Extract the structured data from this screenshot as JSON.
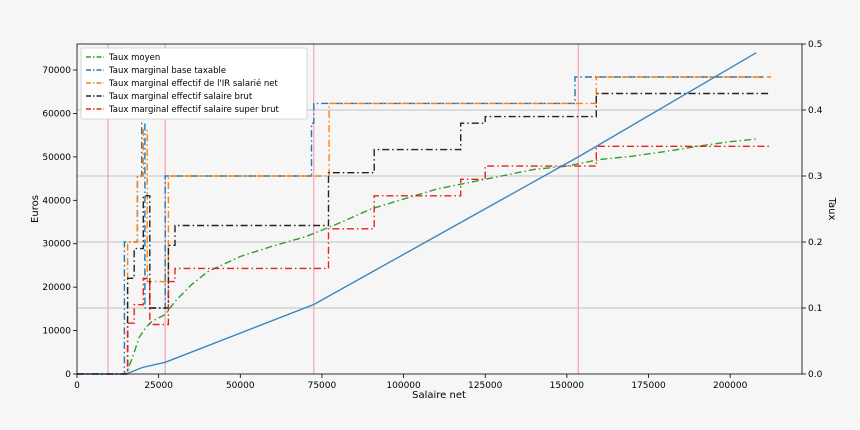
{
  "chart_data": {
    "type": "line",
    "xlabel": "Salaire net",
    "ylabel_left": "Euros",
    "ylabel_right": "Taux",
    "xlim": [
      0,
      222000
    ],
    "ylim_left": [
      0,
      76000
    ],
    "ylim_right": [
      0,
      0.5
    ],
    "x_ticks": [
      0,
      25000,
      50000,
      75000,
      100000,
      125000,
      150000,
      175000,
      200000
    ],
    "y_left_ticks": [
      0,
      10000,
      20000,
      30000,
      40000,
      50000,
      60000,
      70000
    ],
    "y_right_ticks": [
      0.0,
      0.1,
      0.2,
      0.3,
      0.4,
      0.5
    ],
    "grid_right": [
      0.1,
      0.2,
      0.3,
      0.4
    ],
    "vlines": [
      9500,
      27000,
      72500,
      153500
    ],
    "legend_placement": "top-left",
    "series": [
      {
        "name": "Taux moyen",
        "axis": "right",
        "color": "#2ca02c",
        "style": "dashdot",
        "x": [
          0,
          15000,
          17000,
          19000,
          21000,
          23000,
          25000,
          27000,
          30000,
          35000,
          40000,
          50000,
          60000,
          70000,
          80000,
          90000,
          100000,
          110000,
          120000,
          130000,
          140000,
          150000,
          160000,
          170000,
          180000,
          190000,
          200000,
          208000
        ],
        "y": [
          0,
          0,
          0.025,
          0.055,
          0.07,
          0.08,
          0.085,
          0.09,
          0.11,
          0.135,
          0.155,
          0.178,
          0.194,
          0.208,
          0.228,
          0.25,
          0.265,
          0.28,
          0.29,
          0.3,
          0.31,
          0.315,
          0.325,
          0.33,
          0.337,
          0.345,
          0.352,
          0.356
        ]
      },
      {
        "name": "Taux marginal base taxable",
        "axis": "right",
        "color": "#1f77b4",
        "style": "dashdot",
        "x": [
          0,
          14500,
          14500,
          18500,
          18500,
          19800,
          19800,
          20800,
          20800,
          27000,
          27000,
          71800,
          71800,
          72500,
          72500,
          152500,
          152500,
          210000
        ],
        "y": [
          0,
          0,
          0.2,
          0.2,
          0.3,
          0.3,
          0.38,
          0.38,
          0.1,
          0.1,
          0.3,
          0.3,
          0.38,
          0.38,
          0.41,
          0.41,
          0.45,
          0.45
        ]
      },
      {
        "name": "Taux marginal effectif de l'IR salarié net",
        "axis": "right",
        "color": "#ff7f0e",
        "style": "dashdot",
        "x": [
          0,
          15500,
          15500,
          18500,
          18500,
          20300,
          20300,
          21500,
          21500,
          28000,
          28000,
          77200,
          77200,
          159000,
          159000,
          212500
        ],
        "y": [
          0,
          0,
          0.2,
          0.2,
          0.3,
          0.3,
          0.37,
          0.37,
          0.14,
          0.14,
          0.3,
          0.3,
          0.41,
          0.41,
          0.45,
          0.45
        ]
      },
      {
        "name": "Taux marginal effectif salaire brut",
        "axis": "right",
        "color": "#222222",
        "style": "dashdot",
        "x": [
          0,
          15500,
          15500,
          17500,
          17500,
          20300,
          20300,
          22300,
          22300,
          28000,
          28000,
          30000,
          30000,
          77000,
          77000,
          91000,
          91000,
          117500,
          117500,
          125000,
          125000,
          159000,
          159000,
          212500
        ],
        "y": [
          0,
          0,
          0.145,
          0.145,
          0.19,
          0.19,
          0.27,
          0.27,
          0.1,
          0.1,
          0.195,
          0.195,
          0.225,
          0.225,
          0.305,
          0.305,
          0.34,
          0.34,
          0.38,
          0.38,
          0.39,
          0.39,
          0.425,
          0.425
        ]
      },
      {
        "name": "Taux marginal effectif salaire super brut",
        "axis": "right",
        "color": "#e8211d",
        "style": "dashdot",
        "x": [
          0,
          15500,
          15500,
          17500,
          17500,
          20300,
          20300,
          22300,
          22300,
          28000,
          28000,
          30000,
          30000,
          77000,
          77000,
          91000,
          91000,
          117500,
          117500,
          125000,
          125000,
          159000,
          159000,
          212500
        ],
        "y": [
          0,
          0,
          0.077,
          0.077,
          0.105,
          0.105,
          0.145,
          0.145,
          0.075,
          0.075,
          0.14,
          0.14,
          0.16,
          0.16,
          0.22,
          0.22,
          0.27,
          0.27,
          0.295,
          0.295,
          0.315,
          0.315,
          0.345,
          0.345
        ]
      },
      {
        "name": "",
        "axis": "left",
        "color": "#3a87bd",
        "style": "solid",
        "x": [
          0,
          15000,
          20000,
          27000,
          72500,
          153500,
          208000
        ],
        "y": [
          0,
          0,
          1500,
          2700,
          16000,
          50000,
          74000
        ]
      }
    ]
  }
}
